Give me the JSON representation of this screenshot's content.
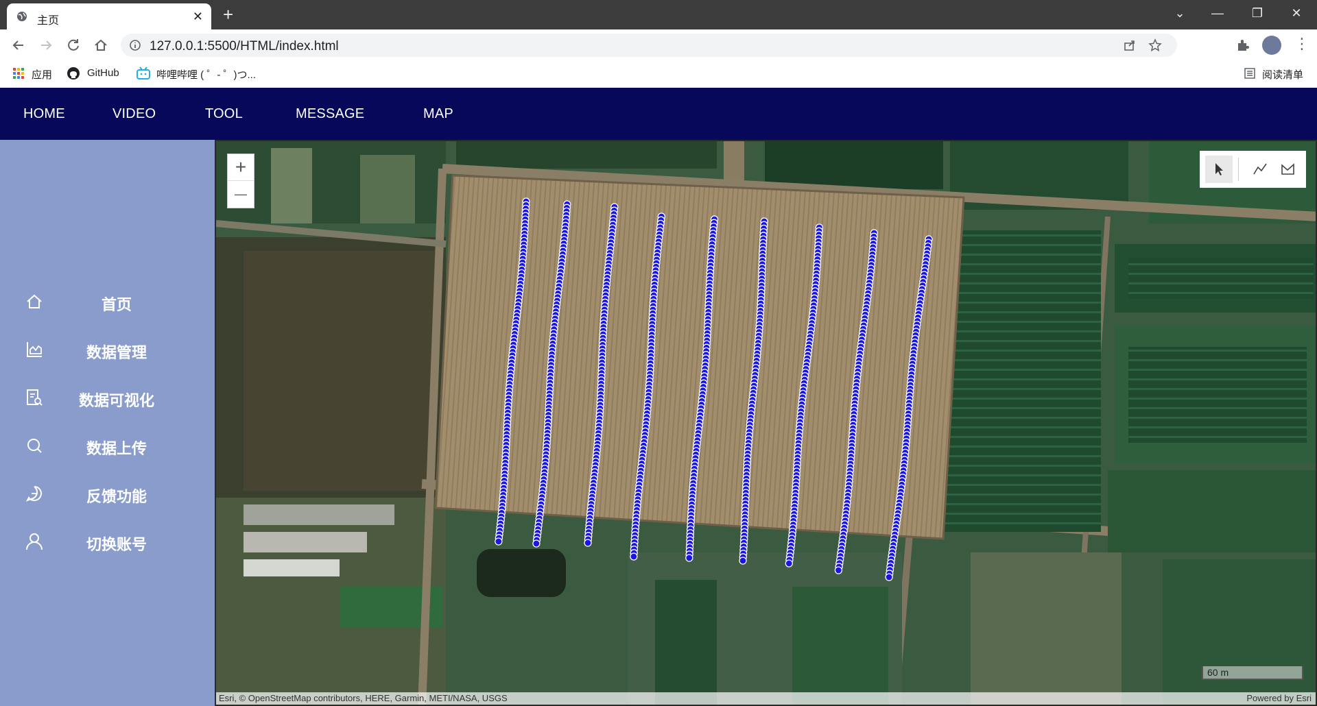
{
  "browser": {
    "tab_title": "主页",
    "url": "127.0.0.1:5500/HTML/index.html",
    "bookmarks": [
      {
        "label": "应用",
        "icon": "apps-grid-icon"
      },
      {
        "label": "GitHub",
        "icon": "github-icon"
      },
      {
        "label": "哔哩哔哩 ( ゜- ゜)つ...",
        "icon": "bilibili-icon"
      }
    ],
    "reading_list": "阅读清单"
  },
  "topnav": {
    "items": [
      "HOME",
      "VIDEO",
      "TOOL",
      "MESSAGE",
      "MAP"
    ]
  },
  "sidebar": {
    "items": [
      {
        "label": "首页",
        "icon": "home-icon"
      },
      {
        "label": "数据管理",
        "icon": "chart-icon"
      },
      {
        "label": "数据可视化",
        "icon": "report-icon"
      },
      {
        "label": "数据上传",
        "icon": "search-icon"
      },
      {
        "label": "反馈功能",
        "icon": "chat-icon"
      },
      {
        "label": "切换账号",
        "icon": "user-icon"
      }
    ]
  },
  "map": {
    "zoom_in": "+",
    "zoom_out": "—",
    "scale_label": "60 m",
    "attribution": "Esri, © OpenStreetMap contributors, HERE, Garmin, METI/NASA, USGS",
    "powered_by": "Powered by Esri",
    "tools": [
      "select-pointer-icon",
      "polyline-icon",
      "polygon-icon"
    ],
    "point_color": "#1a14e6",
    "track_count": 9
  }
}
